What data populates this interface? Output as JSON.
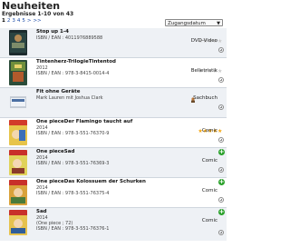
{
  "page": {
    "title": "Neuheiten",
    "results": "Ergebnisse 1-10 von 43",
    "pager": [
      "1",
      "2",
      "3",
      "4",
      "5",
      ">",
      ">>"
    ],
    "sort_label": "Zugangsdatum"
  },
  "items": [
    {
      "title": "Stop up 1-4",
      "year": "",
      "id": "ISBN / EAN : 4011976889588",
      "extra": "",
      "medium": "DVD-Video",
      "rating": 0
    },
    {
      "title": "Tintenherz-TrilogieTintentod",
      "year": "2012",
      "id": "ISBN / EAN : 978-3-8415-0014-4",
      "extra": "",
      "medium": "Belletristik",
      "rating": 0
    },
    {
      "title": "Fit ohne Geräte",
      "year": "",
      "id": "Mark Lauren mit Joshua Clark",
      "extra": "",
      "medium": "Sachbuch",
      "rating": 0
    },
    {
      "title": "One pieceDer Flamingo taucht auf",
      "year": "2014",
      "id": "ISBN / EAN : 978-3-551-76370-9",
      "extra": "",
      "medium": "Comic",
      "rating": 5
    },
    {
      "title": "One pieceSad",
      "year": "2014",
      "id": "ISBN / EAN : 978-3-551-76369-3",
      "extra": "",
      "medium": "Comic",
      "rating": 0
    },
    {
      "title": "One pieceDas Kolossuem der Schurken",
      "year": "2014",
      "id": "ISBN / EAN : 978-3-551-76375-4",
      "extra": "",
      "medium": "Comic",
      "rating": 0
    },
    {
      "title": "Sad",
      "year": "2014",
      "id": "",
      "extra": "(One piece ; 72)",
      "isbn2": "ISBN / EAN : 978-3-551-76376-1",
      "medium": "Comic",
      "rating": 0
    }
  ],
  "colors": {
    "star_on": "#f3a610",
    "star_off": "#c9c9c9",
    "add_green": "#2aa12a",
    "row_shade": "#eef1f5"
  }
}
